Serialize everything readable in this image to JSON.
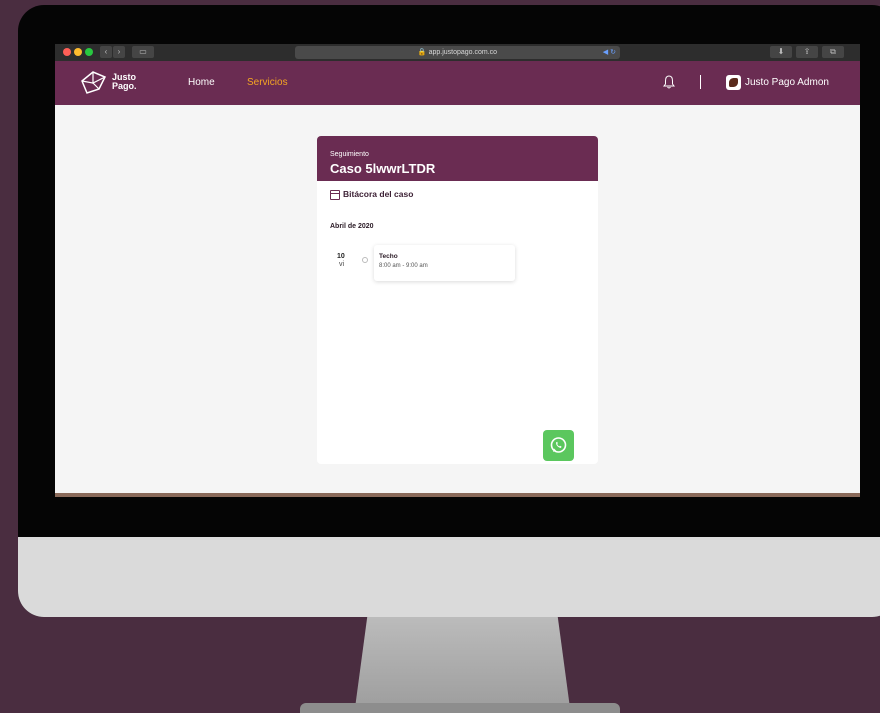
{
  "browser": {
    "url": "app.justopago.com.co"
  },
  "header": {
    "logo_line1": "Justo",
    "logo_line2": "Pago.",
    "nav": [
      {
        "label": "Home",
        "active": false
      },
      {
        "label": "Servicios",
        "active": true
      }
    ],
    "user_name": "Justo Pago Admon"
  },
  "card": {
    "overline": "Seguimiento",
    "title": "Caso 5lwwrLTDR",
    "section_title": "Bitácora del caso",
    "month_label": "Abril de 2020",
    "event": {
      "day_number": "10",
      "day_name": "vi",
      "title": "Techo",
      "time": "8:00 am - 9:00 am"
    }
  },
  "colors": {
    "brand": "#6a2c52",
    "active_nav": "#f5a623",
    "whatsapp": "#5bc75e",
    "backdrop": "#4a2d40"
  },
  "icons": [
    "bell-icon",
    "calendar-icon",
    "whatsapp-icon"
  ]
}
